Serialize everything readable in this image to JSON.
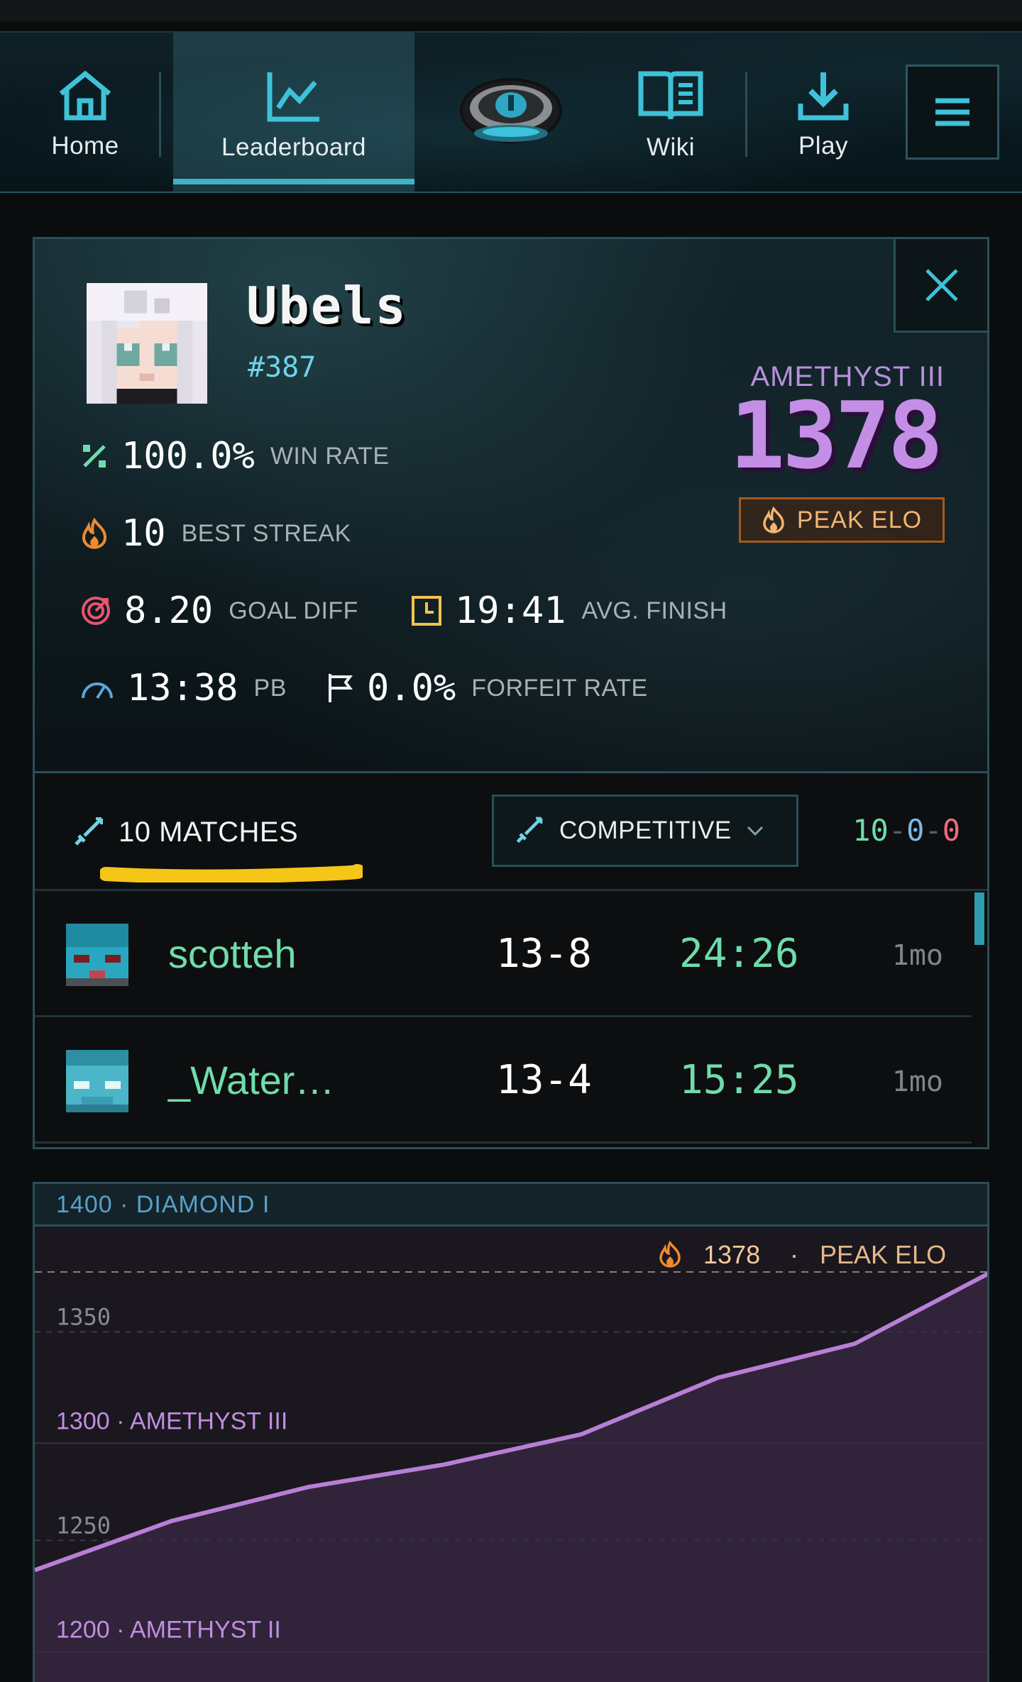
{
  "nav": {
    "home_label": "Home",
    "leaderboard_label": "Leaderboard",
    "wiki_label": "Wiki",
    "play_label": "Play",
    "active": "Leaderboard"
  },
  "profile": {
    "name": "Ubels",
    "rank": "#387",
    "tier": "AMETHYST III",
    "elo": "1378",
    "peak_label": "PEAK ELO",
    "stats": {
      "win_rate": {
        "value": "100.0%",
        "label": "WIN RATE"
      },
      "best_streak": {
        "value": "10",
        "label": "BEST STREAK"
      },
      "goal_diff": {
        "value": "8.20",
        "label": "GOAL DIFF"
      },
      "avg_finish": {
        "value": "19:41",
        "label": "AVG. FINISH"
      },
      "pb": {
        "value": "13:38",
        "label": "PB"
      },
      "forfeit_rate": {
        "value": "0.0%",
        "label": "FORFEIT RATE"
      }
    }
  },
  "matches": {
    "count_label": "10 MATCHES",
    "mode": "COMPETITIVE",
    "record": {
      "wins": "10",
      "draws": "0",
      "losses": "0",
      "sep": "-"
    },
    "rows": [
      {
        "opponent": "scotteh",
        "score": "13-8",
        "time": "24:26",
        "ago": "1mo"
      },
      {
        "opponent": "_Water…",
        "score": "13-4",
        "time": "15:25",
        "ago": "1mo"
      }
    ]
  },
  "chart_data": {
    "type": "line",
    "title": "",
    "band_labels": [
      {
        "text": "1400 · DIAMOND I",
        "value": 1400
      },
      {
        "text": "1300 · AMETHYST III",
        "value": 1300
      },
      {
        "text": "1200 · AMETHYST II",
        "value": 1200
      }
    ],
    "tick_labels": [
      {
        "text": "1350",
        "value": 1350
      },
      {
        "text": "1250",
        "value": 1250
      }
    ],
    "peak": {
      "value": "1378",
      "sep": "·",
      "label": "PEAK ELO"
    },
    "series": [
      {
        "values": [
          1220,
          1246,
          1264,
          1276,
          1292,
          1322,
          1340,
          1378
        ]
      }
    ],
    "ylim": [
      1190,
      1420
    ],
    "line_color": "#b87fd6",
    "fill_color": "#3a2944"
  }
}
